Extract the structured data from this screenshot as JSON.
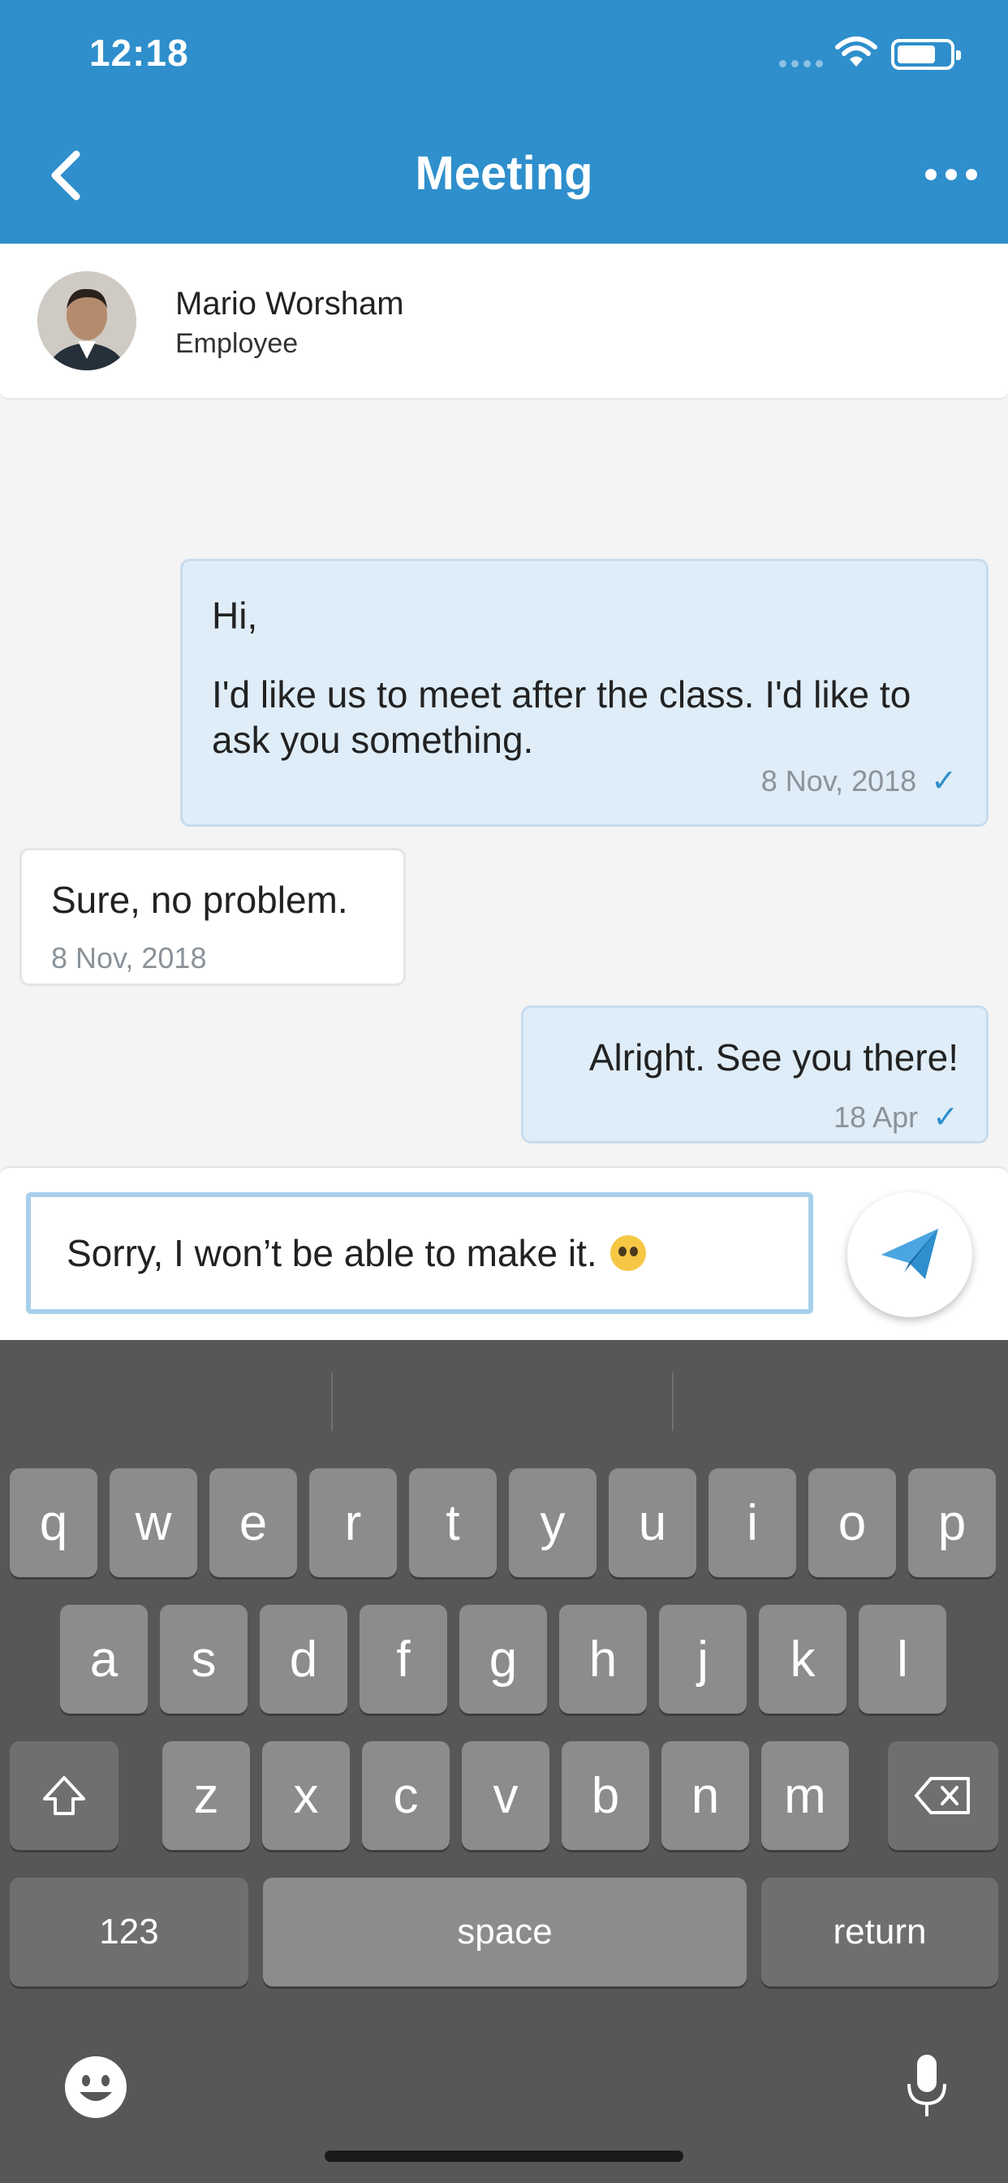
{
  "status_bar": {
    "time": "12:18"
  },
  "header": {
    "title": "Meeting"
  },
  "contact": {
    "name": "Mario Worsham",
    "role": "Employee"
  },
  "messages": [
    {
      "direction": "outgoing",
      "line1": "Hi,",
      "line2": "I'd like us to meet after the class. I'd like to ask you something.",
      "date": "8 Nov, 2018",
      "read": true
    },
    {
      "direction": "incoming",
      "text": "Sure, no problem.",
      "date": "8 Nov, 2018"
    },
    {
      "direction": "outgoing",
      "text": "Alright. See you there!",
      "date": "18 Apr",
      "read": true
    }
  ],
  "composer": {
    "value": "Sorry, I won’t be able to make it.",
    "emoji": "pleading-face"
  },
  "keyboard": {
    "row1": [
      "q",
      "w",
      "e",
      "r",
      "t",
      "y",
      "u",
      "i",
      "o",
      "p"
    ],
    "row2": [
      "a",
      "s",
      "d",
      "f",
      "g",
      "h",
      "j",
      "k",
      "l"
    ],
    "row3": [
      "z",
      "x",
      "c",
      "v",
      "b",
      "n",
      "m"
    ],
    "numbers_label": "123",
    "space_label": "space",
    "return_label": "return"
  },
  "colors": {
    "accent": "#2e8fcc",
    "outgoing_bubble": "#dfedf8",
    "keyboard_bg": "#575757"
  }
}
